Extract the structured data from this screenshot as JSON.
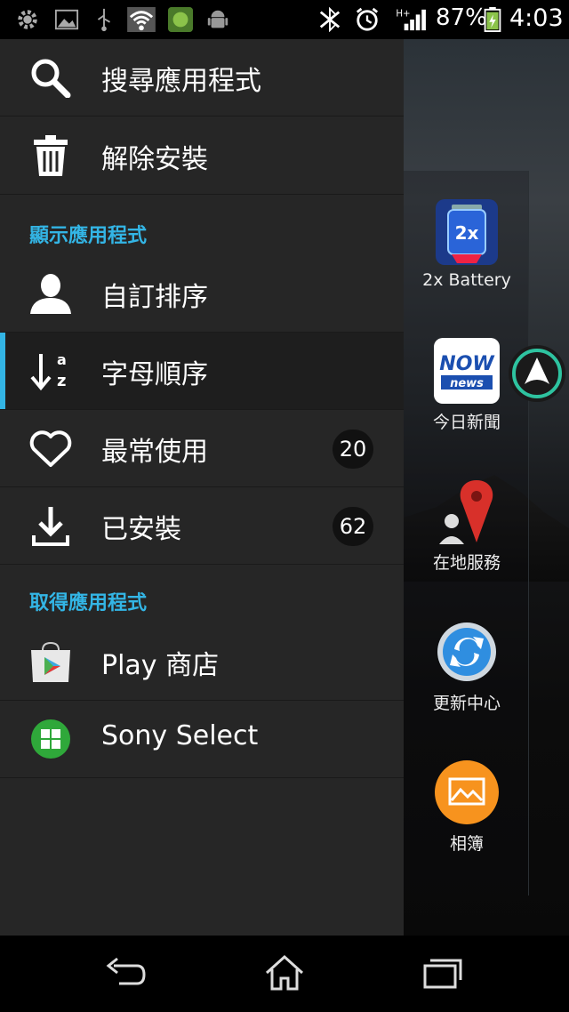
{
  "status_bar": {
    "battery_percent": "87%",
    "time": "4:03",
    "network_type": "H+",
    "icons": [
      "settings-icon",
      "image-icon",
      "usb-icon",
      "wifi-icon",
      "shield-icon",
      "android-icon",
      "bluetooth-icon",
      "alarm-icon",
      "signal-icon",
      "battery-icon"
    ]
  },
  "drawer": {
    "top_items": [
      {
        "label": "搜尋應用程式",
        "icon": "search-icon"
      },
      {
        "label": "解除安裝",
        "icon": "trash-icon"
      }
    ],
    "section_show": "顯示應用程式",
    "show_items": [
      {
        "label": "自訂排序",
        "icon": "person-icon",
        "selected": false
      },
      {
        "label": "字母順序",
        "icon": "sort-az-icon",
        "selected": true
      },
      {
        "label": "最常使用",
        "icon": "heart-icon",
        "count": "20"
      },
      {
        "label": "已安裝",
        "icon": "download-icon",
        "count": "62"
      }
    ],
    "section_get": "取得應用程式",
    "get_items": [
      {
        "label": "Play 商店",
        "icon": "play-store-icon"
      },
      {
        "label": "Sony Select",
        "icon": "sony-select-icon"
      }
    ]
  },
  "home_apps": [
    {
      "label": "2x Battery",
      "icon": "battery-app-icon"
    },
    {
      "label": "今日新聞",
      "icon": "now-news-icon"
    },
    {
      "label": "在地服務",
      "icon": "local-service-icon"
    },
    {
      "label": "更新中心",
      "icon": "update-center-icon"
    },
    {
      "label": "相簿",
      "icon": "album-icon"
    }
  ],
  "nav_bar": [
    "back-icon",
    "home-icon",
    "recents-icon"
  ],
  "colors": {
    "accent": "#33b5e5",
    "drawer_bg": "#262626"
  }
}
